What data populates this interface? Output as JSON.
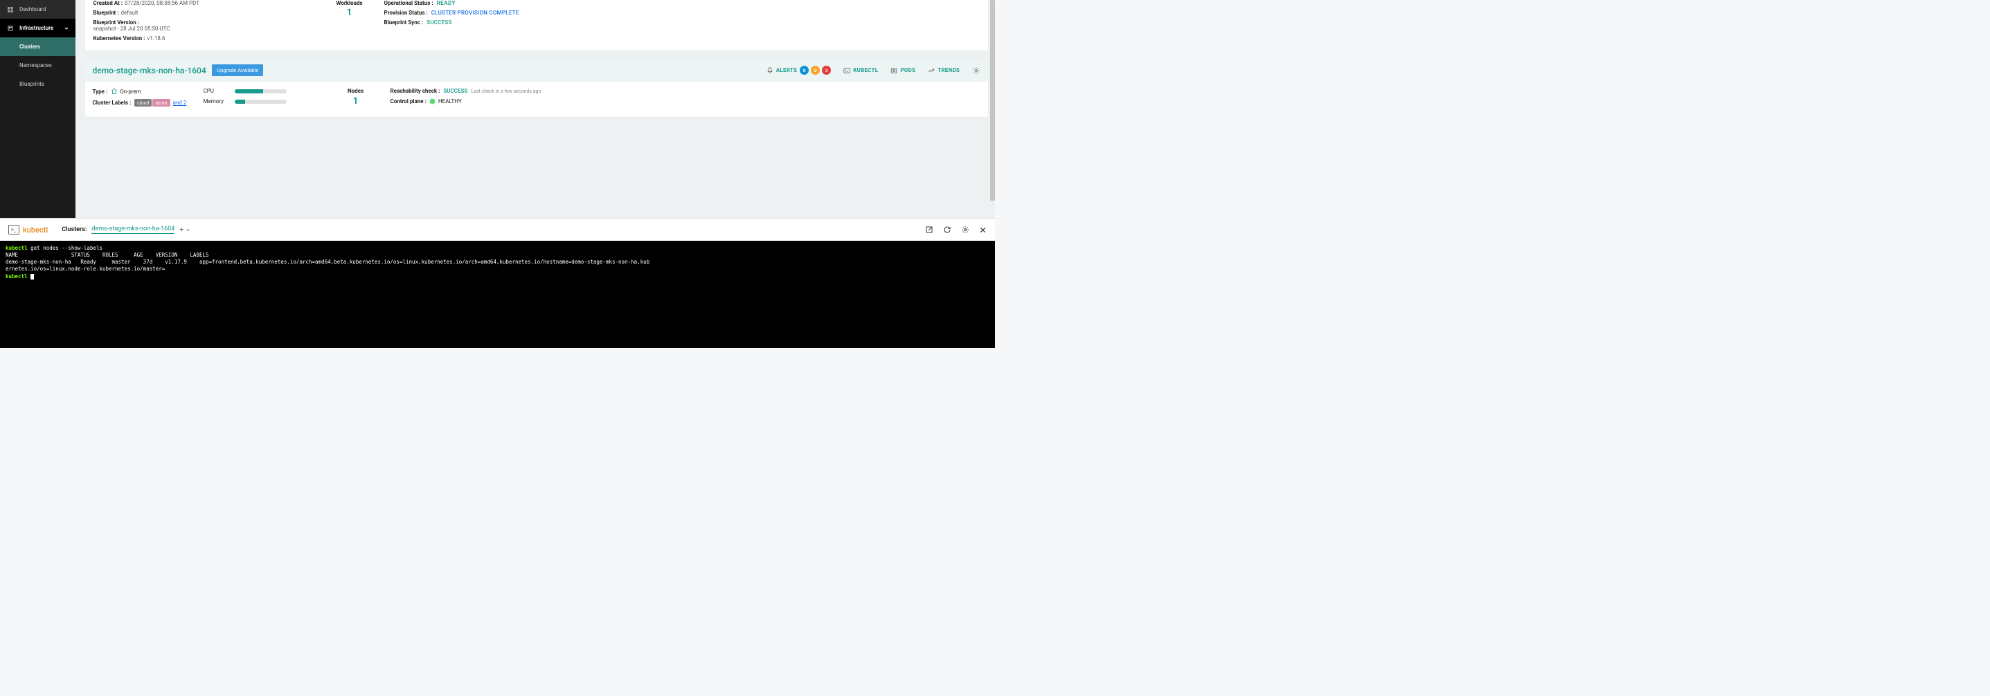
{
  "sidebar": {
    "dashboard": "Dashboard",
    "infrastructure": "Infrastructure",
    "clusters": "Clusters",
    "namespaces": "Namespaces",
    "blueprints": "Blueprints"
  },
  "cluster1": {
    "created_at_label": "Created At :",
    "created_at": "07/28/2020, 08:38:56 AM PDT",
    "blueprint_label": "Blueprint :",
    "blueprint": "default",
    "blueprint_version_label": "Blueprint Version :",
    "blueprint_version": "snapshot - 28 Jul 20 05:50 UTC",
    "k8s_version_label": "Kubernetes Version :",
    "k8s_version": "v1.18.6",
    "workloads_label": "Workloads",
    "workloads_count": "1",
    "op_status_label": "Operational Status :",
    "op_status": "READY",
    "prov_status_label": "Provision Status :",
    "prov_status": "CLUSTER PROVISION COMPLETE",
    "bp_sync_label": "Blueprint Sync :",
    "bp_sync": "SUCCESS"
  },
  "cluster2": {
    "name": "demo-stage-mks-non-ha-1604",
    "upgrade_btn": "Upgrade Available",
    "alerts_label": "ALERTS",
    "alert_blue": "0",
    "alert_orange": "0",
    "alert_red": "3",
    "kubectl_label": "KUBECTL",
    "pods_label": "PODS",
    "trends_label": "TRENDS",
    "type_label": "Type :",
    "type_val": "On-prem",
    "labels_label": "Cluster Labels :",
    "pill_cloud": "cloud",
    "pill_azure": "azure",
    "and2": "and 2",
    "cpu_label": "CPU",
    "cpu_pct": 55,
    "mem_label": "Memory",
    "mem_pct": 20,
    "nodes_label": "Nodes",
    "nodes_count": "1",
    "reach_label": "Reachability check :",
    "reach_val": "SUCCESS",
    "reach_sub": "Last check in a few seconds ago",
    "cp_label": "Control plane :",
    "cp_val": "HEALTHY"
  },
  "kubectl_bar": {
    "brand": "kubectl",
    "clusters_label": "Clusters:",
    "selected": "demo-stage-mks-non-ha-1604",
    "add": "+"
  },
  "terminal": {
    "cmd_prefix": "kubectl ",
    "cmd_rest": "get nodes --show-labels",
    "header": "NAME                 STATUS    ROLES     AGE    VERSION    LABELS",
    "row": "demo-stage-mks-non-ha   Ready     master    37d    v1.17.9    app=frontend,beta.kubernetes.io/arch=amd64,beta.kubernetes.io/os=linux,kubernetes.io/arch=amd64,kubernetes.io/hostname=demo-stage-mks-non-ha,kub",
    "row2": "ernetes.io/os=linux,node-role.kubernetes.io/master=",
    "prompt": "kubectl "
  }
}
